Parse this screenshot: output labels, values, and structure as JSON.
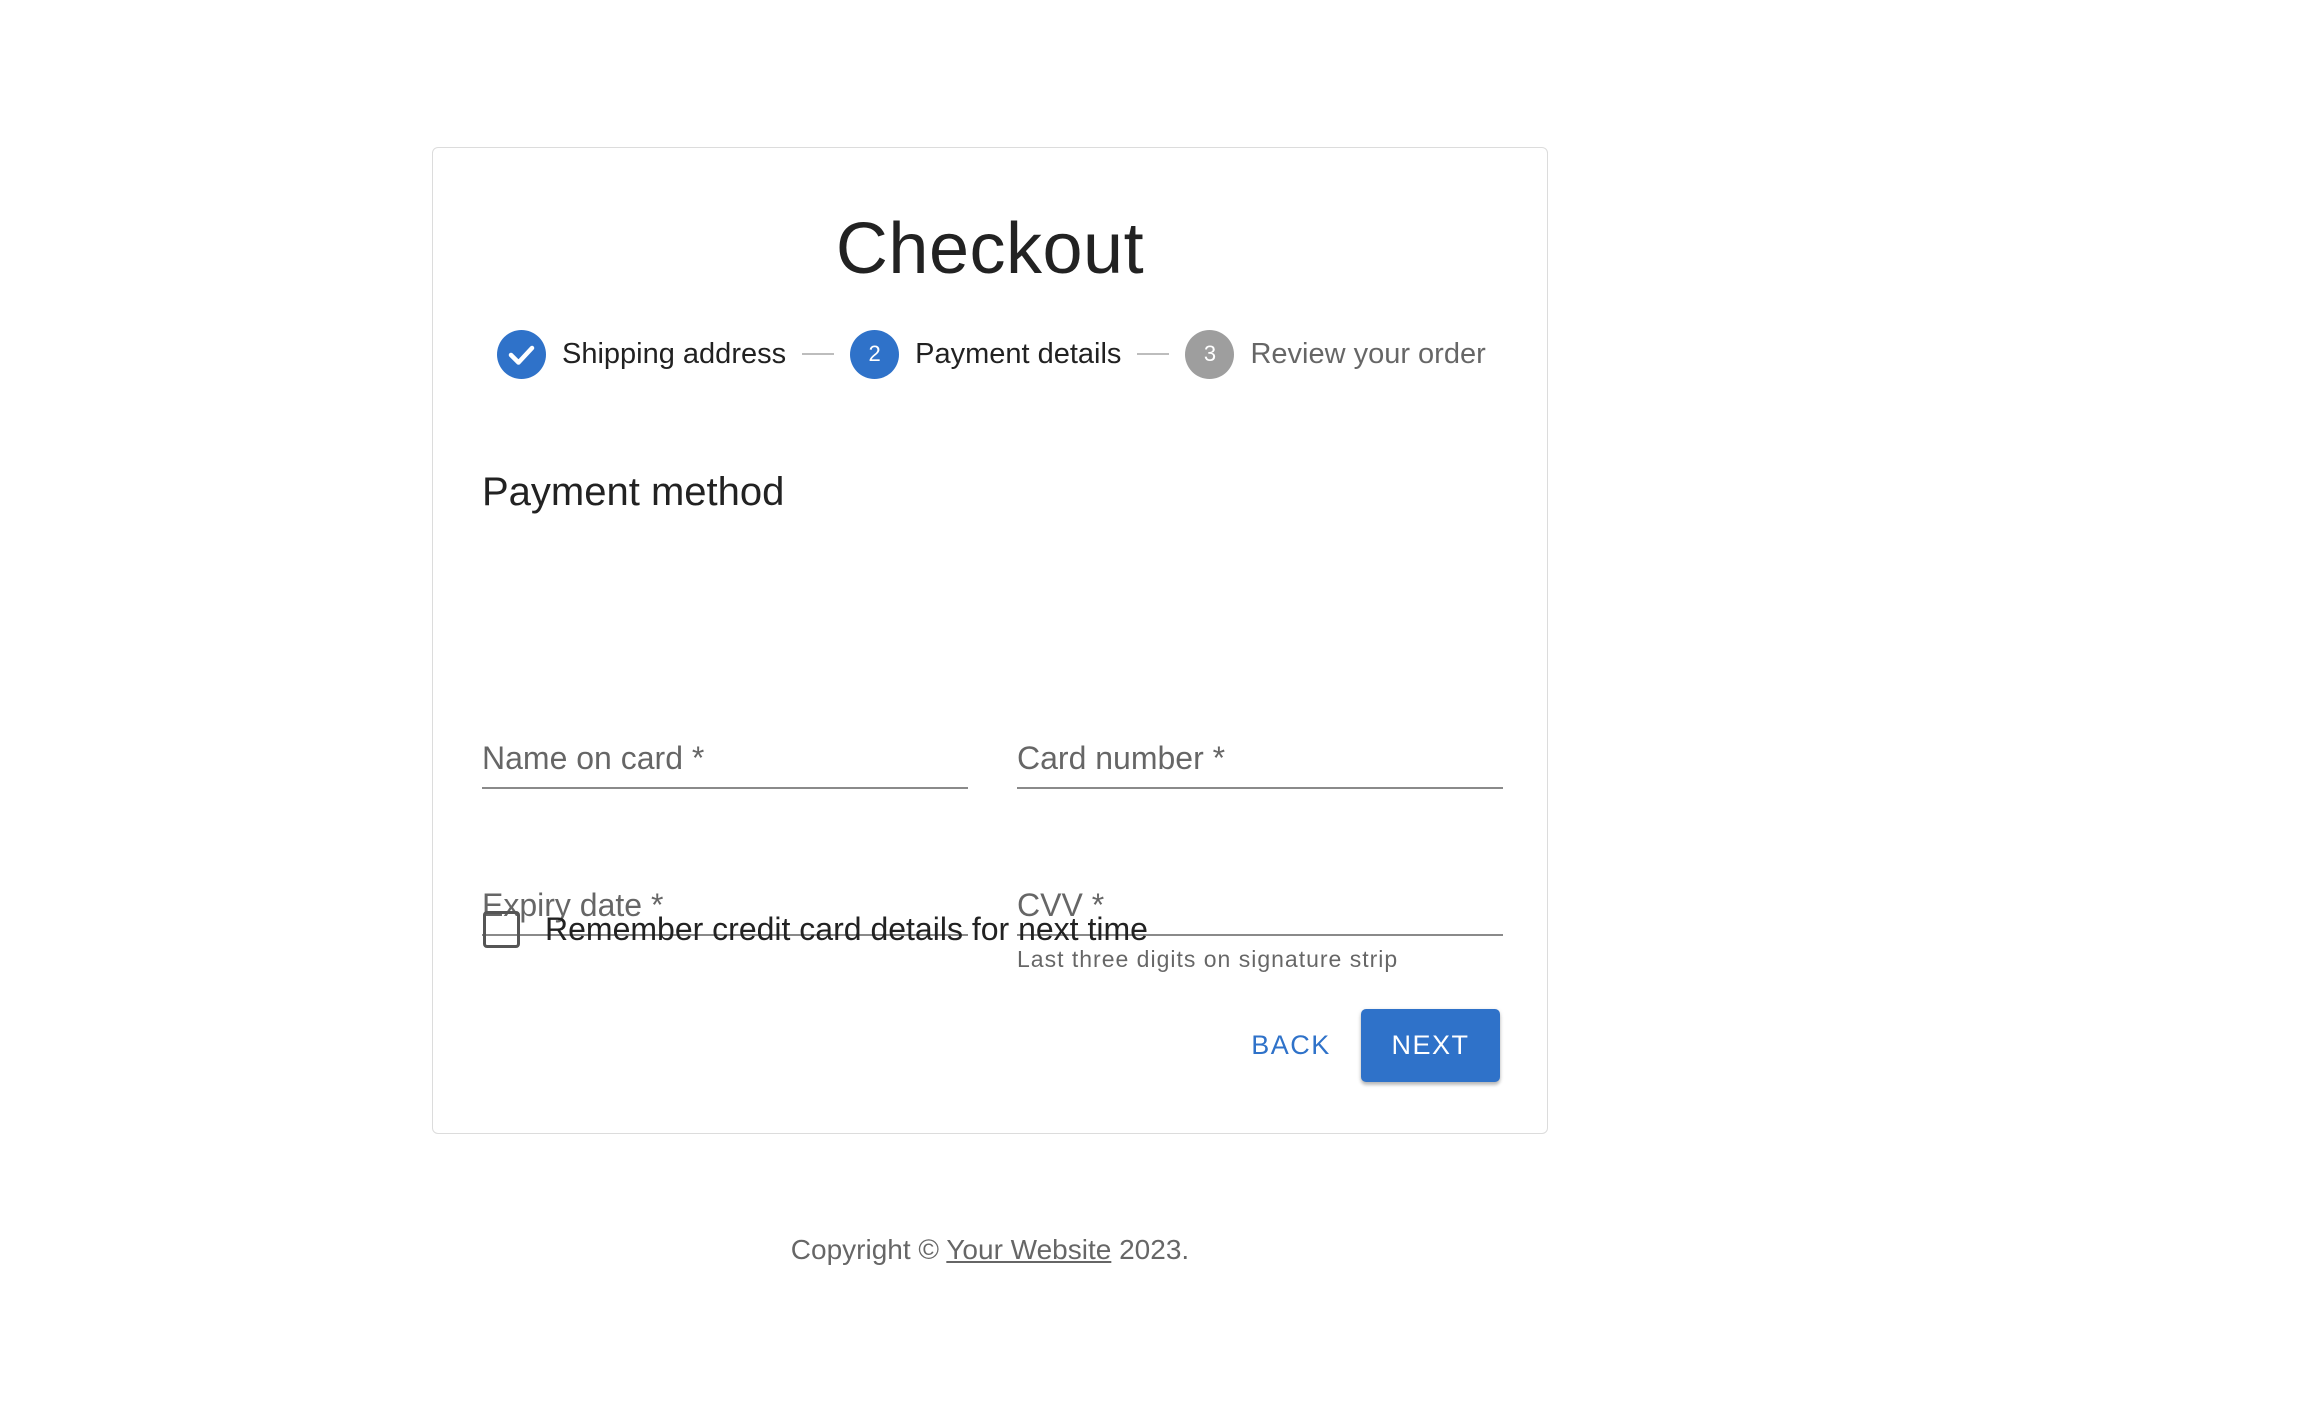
{
  "checkout": {
    "title": "Checkout",
    "steps": [
      {
        "label": "Shipping address",
        "state": "completed",
        "icon": "check-icon"
      },
      {
        "label": "Payment details",
        "state": "active",
        "number": "2"
      },
      {
        "label": "Review your order",
        "state": "pending",
        "number": "3"
      }
    ],
    "section_title": "Payment method",
    "fields": {
      "name_on_card": {
        "label": "Name on card *",
        "value": ""
      },
      "card_number": {
        "label": "Card number *",
        "value": ""
      },
      "expiry_date": {
        "label": "Expiry date *",
        "value": ""
      },
      "cvv": {
        "label": "CVV *",
        "value": "",
        "helper": "Last three digits on signature strip"
      }
    },
    "remember": {
      "label": "Remember credit card details for next time",
      "checked": false
    },
    "buttons": {
      "back": "BACK",
      "next": "NEXT"
    }
  },
  "footer": {
    "prefix": "Copyright © ",
    "link_text": "Your Website",
    "suffix": " 2023."
  },
  "colors": {
    "primary": "#2f72c9",
    "pending_step": "#9e9e9e"
  }
}
